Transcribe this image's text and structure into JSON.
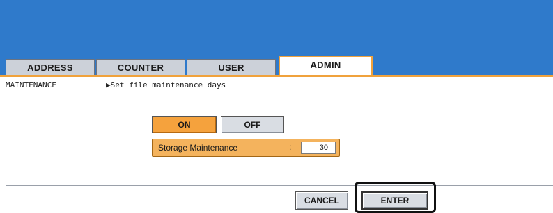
{
  "tabs": [
    {
      "label": "ADDRESS",
      "active": false
    },
    {
      "label": "COUNTER",
      "active": false
    },
    {
      "label": "USER",
      "active": false
    },
    {
      "label": "ADMIN",
      "active": true
    }
  ],
  "breadcrumb": {
    "menu": "MAINTENANCE",
    "instruction": "▶Set file maintenance days"
  },
  "toggle": {
    "on_label": "ON",
    "off_label": "OFF",
    "selected": "ON"
  },
  "storage": {
    "label": "Storage Maintenance",
    "separator": ":",
    "value": "30"
  },
  "actions": {
    "cancel_label": "CANCEL",
    "enter_label": "ENTER"
  },
  "colors": {
    "header": "#2f7acb",
    "accent": "#f5a23d",
    "tab_inactive": "#ccd1d9"
  }
}
